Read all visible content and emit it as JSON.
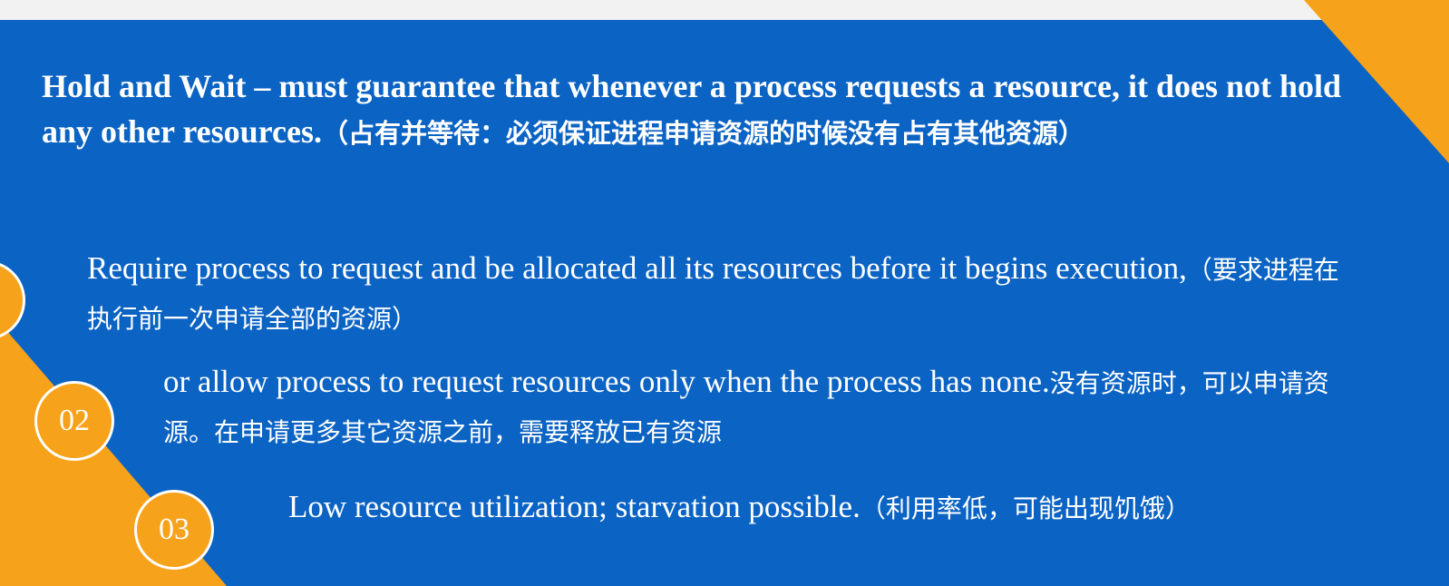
{
  "heading": {
    "en": "Hold and Wait – must guarantee that whenever a process requests a resource, it does not hold any other resources.",
    "zh": "（占有并等待：必须保证进程申请资源的时候没有占有其他资源）"
  },
  "points": [
    {
      "en": "Require process to request and be allocated all its resources before it begins execution,",
      "zh": "（要求进程在执行前一次申请全部的资源）"
    },
    {
      "number": "02",
      "en": "or allow process to request resources only when the process has none.",
      "zh": "没有资源时，可以申请资源。在申请更多其它资源之前，需要释放已有资源"
    },
    {
      "number": "03",
      "en": "Low resource utilization; starvation possible.",
      "zh": "（利用率低，可能出现饥饿）"
    }
  ],
  "colors": {
    "background_blue": "#0b63c4",
    "accent_orange": "#f7a21b",
    "text": "#ffffff"
  }
}
